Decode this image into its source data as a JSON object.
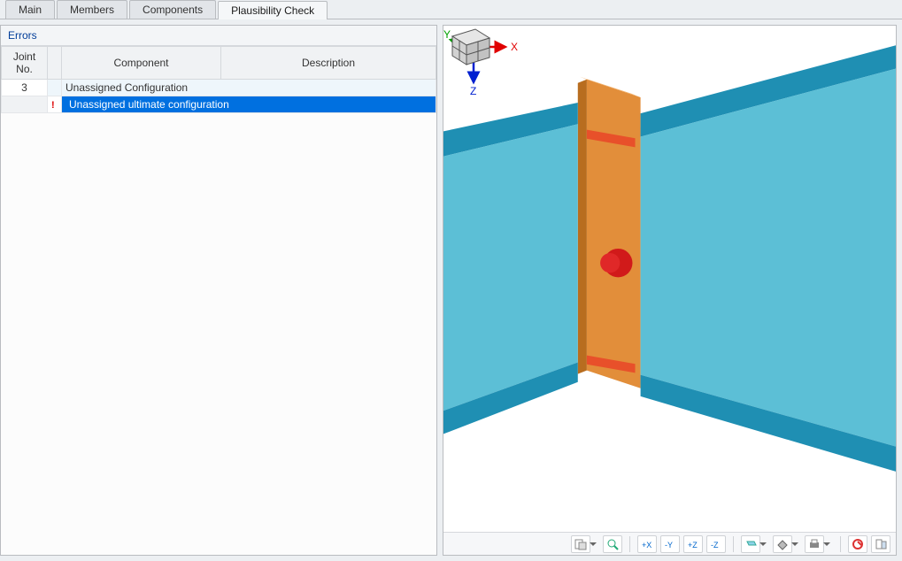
{
  "tabs": {
    "main": "Main",
    "members": "Members",
    "components": "Components",
    "plausibility": "Plausibility Check"
  },
  "active_tab": "plausibility",
  "panel": {
    "header": "Errors"
  },
  "grid": {
    "headers": {
      "joint": "Joint\nNo.",
      "component": "Component",
      "description": "Description"
    },
    "rows": [
      {
        "type": "header",
        "joint": "3",
        "icon": "",
        "text": "Unassigned Configuration",
        "span": "full"
      },
      {
        "type": "selected",
        "joint": "",
        "icon": "!",
        "text": "Unassigned ultimate configuration",
        "span": "full"
      }
    ]
  },
  "viewport": {
    "axes": {
      "x": "X",
      "y": "Y",
      "z": "Z"
    },
    "colors": {
      "beam_face": "#5cbfd6",
      "beam_dark": "#1f8fb3",
      "plate_face": "#e28e3a",
      "plate_side": "#b86d1f",
      "bolt": "#d11a1a",
      "weld": "#e8502a"
    }
  },
  "toolbar": {
    "btns": {
      "options": "options",
      "zoom_extents": "zoom-extents",
      "view_x": "view-x",
      "view_neg_y": "view-neg-y",
      "view_z": "view-z",
      "view_neg_z": "view-neg-z",
      "render": "render-mode",
      "display": "display-mode",
      "print": "print",
      "labels": "labels",
      "close": "close"
    }
  }
}
